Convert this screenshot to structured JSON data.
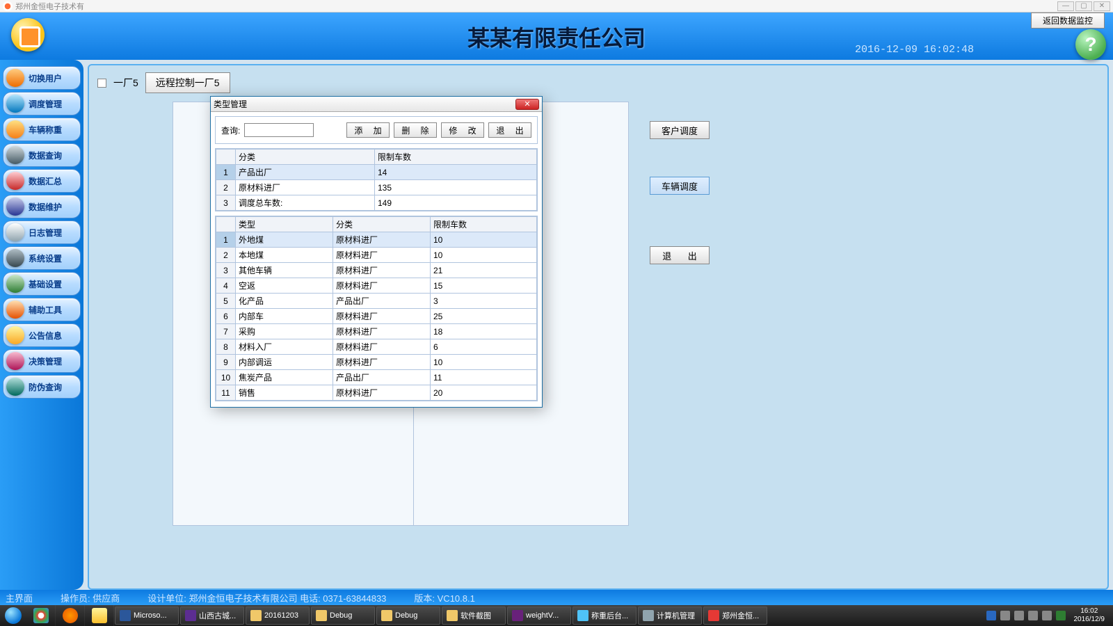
{
  "window": {
    "title": "郑州金恒电子技术有"
  },
  "header": {
    "company": "某某有限责任公司",
    "datetime": "2016-12-09 16:02:48",
    "back_btn": "返回数据监控",
    "help": "?"
  },
  "sidebar": [
    {
      "label": "切换用户",
      "color": "linear-gradient(#ffcc80,#ef6c00)"
    },
    {
      "label": "调度管理",
      "color": "linear-gradient(#b3e5fc,#0277bd)"
    },
    {
      "label": "车辆称重",
      "color": "linear-gradient(#ffe082,#f57f17)"
    },
    {
      "label": "数据查询",
      "color": "linear-gradient(#cfd8dc,#455a64)"
    },
    {
      "label": "数据汇总",
      "color": "linear-gradient(#ffcdd2,#c62828)"
    },
    {
      "label": "数据维护",
      "color": "linear-gradient(#c5cae9,#283593)"
    },
    {
      "label": "日志管理",
      "color": "linear-gradient(#fff,#90a4ae)"
    },
    {
      "label": "系统设置",
      "color": "linear-gradient(#b0bec5,#37474f)"
    },
    {
      "label": "基础设置",
      "color": "linear-gradient(#c8e6c9,#2e7d32)"
    },
    {
      "label": "辅助工具",
      "color": "linear-gradient(#ffe0b2,#e65100)"
    },
    {
      "label": "公告信息",
      "color": "linear-gradient(#fff59d,#f9a825)"
    },
    {
      "label": "决策管理",
      "color": "linear-gradient(#f8bbd0,#ad1457)"
    },
    {
      "label": "防伪查询",
      "color": "linear-gradient(#b2dfdb,#00695c)"
    }
  ],
  "main": {
    "factory_label": "一厂5",
    "remote_btn": "远程控制一厂5",
    "btn_customer": "客户调度",
    "btn_vehicle": "车辆调度",
    "btn_exit": "退  出"
  },
  "dialog": {
    "title": "类型管理",
    "query_label": "查询:",
    "btn_add": "添 加",
    "btn_del": "删 除",
    "btn_mod": "修 改",
    "btn_exit": "退 出",
    "table1": {
      "cols": [
        "分类",
        "限制车数"
      ],
      "rows": [
        {
          "n": "1",
          "c": [
            "产品出厂",
            "14"
          ]
        },
        {
          "n": "2",
          "c": [
            "原材料进厂",
            "135"
          ]
        },
        {
          "n": "3",
          "c": [
            "调度总车数:",
            "149"
          ]
        }
      ]
    },
    "table2": {
      "cols": [
        "类型",
        "分类",
        "限制车数"
      ],
      "rows": [
        {
          "n": "1",
          "c": [
            "外地煤",
            "原材料进厂",
            "10"
          ]
        },
        {
          "n": "2",
          "c": [
            "本地煤",
            "原材料进厂",
            "10"
          ]
        },
        {
          "n": "3",
          "c": [
            "其他车辆",
            "原材料进厂",
            "21"
          ]
        },
        {
          "n": "4",
          "c": [
            "空返",
            "原材料进厂",
            "15"
          ]
        },
        {
          "n": "5",
          "c": [
            "化产品",
            "产品出厂",
            "3"
          ]
        },
        {
          "n": "6",
          "c": [
            "内部车",
            "原材料进厂",
            "25"
          ]
        },
        {
          "n": "7",
          "c": [
            "采购",
            "原材料进厂",
            "18"
          ]
        },
        {
          "n": "8",
          "c": [
            "材料入厂",
            "原材料进厂",
            "6"
          ]
        },
        {
          "n": "9",
          "c": [
            "内部调运",
            "原材料进厂",
            "10"
          ]
        },
        {
          "n": "10",
          "c": [
            "焦炭产品",
            "产品出厂",
            "11"
          ]
        },
        {
          "n": "11",
          "c": [
            "销售",
            "原材料进厂",
            "20"
          ]
        }
      ]
    }
  },
  "footer": {
    "main": "主界面",
    "operator": "操作员: 供应商",
    "designer": "设计单位: 郑州金恒电子技术有限公司 电话: 0371-63844833",
    "version": "版本: VC10.8.1"
  },
  "taskbar": {
    "items": [
      {
        "label": "Microso...",
        "color": "#2b579a"
      },
      {
        "label": "山西古城...",
        "color": "#5c2d91"
      },
      {
        "label": "20161203",
        "color": "#f0c869"
      },
      {
        "label": "Debug",
        "color": "#f0c869"
      },
      {
        "label": "Debug",
        "color": "#f0c869"
      },
      {
        "label": "软件截图",
        "color": "#f0c869"
      },
      {
        "label": "weightV...",
        "color": "#68217a"
      },
      {
        "label": "称重后台...",
        "color": "#4fc3f7"
      },
      {
        "label": "计算机管理",
        "color": "#90a4ae"
      },
      {
        "label": "郑州金恒...",
        "color": "#e53935"
      }
    ],
    "time": "16:02",
    "date": "2016/12/9"
  }
}
